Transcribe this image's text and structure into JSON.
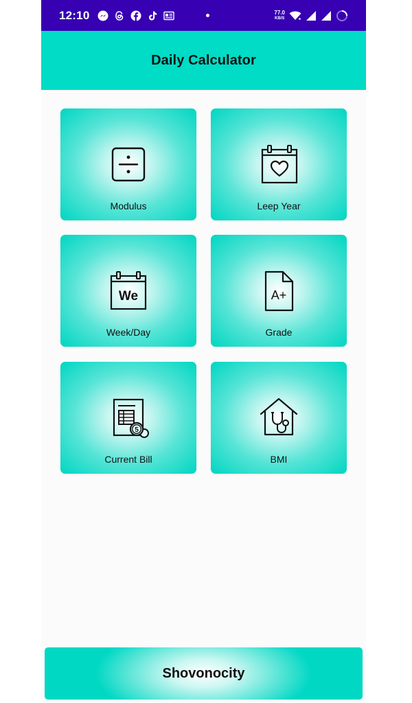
{
  "status_bar": {
    "time": "12:10",
    "net_speed_value": "77.0",
    "net_speed_unit": "KB/S",
    "icons": [
      "messenger-icon",
      "threads-icon",
      "facebook-icon",
      "tiktok-icon",
      "news-icon"
    ]
  },
  "app_bar": {
    "title": "Daily Calculator"
  },
  "tiles": [
    {
      "label": "Modulus",
      "icon": "divide-icon"
    },
    {
      "label": "Leep Year",
      "icon": "calendar-heart-icon"
    },
    {
      "label": "Week/Day",
      "icon": "calendar-week-icon",
      "icon_text": "We"
    },
    {
      "label": "Grade",
      "icon": "grade-document-icon",
      "icon_text": "A+"
    },
    {
      "label": "Current Bill",
      "icon": "bill-icon",
      "icon_text": "5"
    },
    {
      "label": "BMI",
      "icon": "health-house-icon"
    }
  ],
  "footer": {
    "text": "Shovonocity"
  },
  "colors": {
    "status_bar": "#3700b3",
    "accent": "#00dcc6",
    "background": "#fbfbfb"
  }
}
